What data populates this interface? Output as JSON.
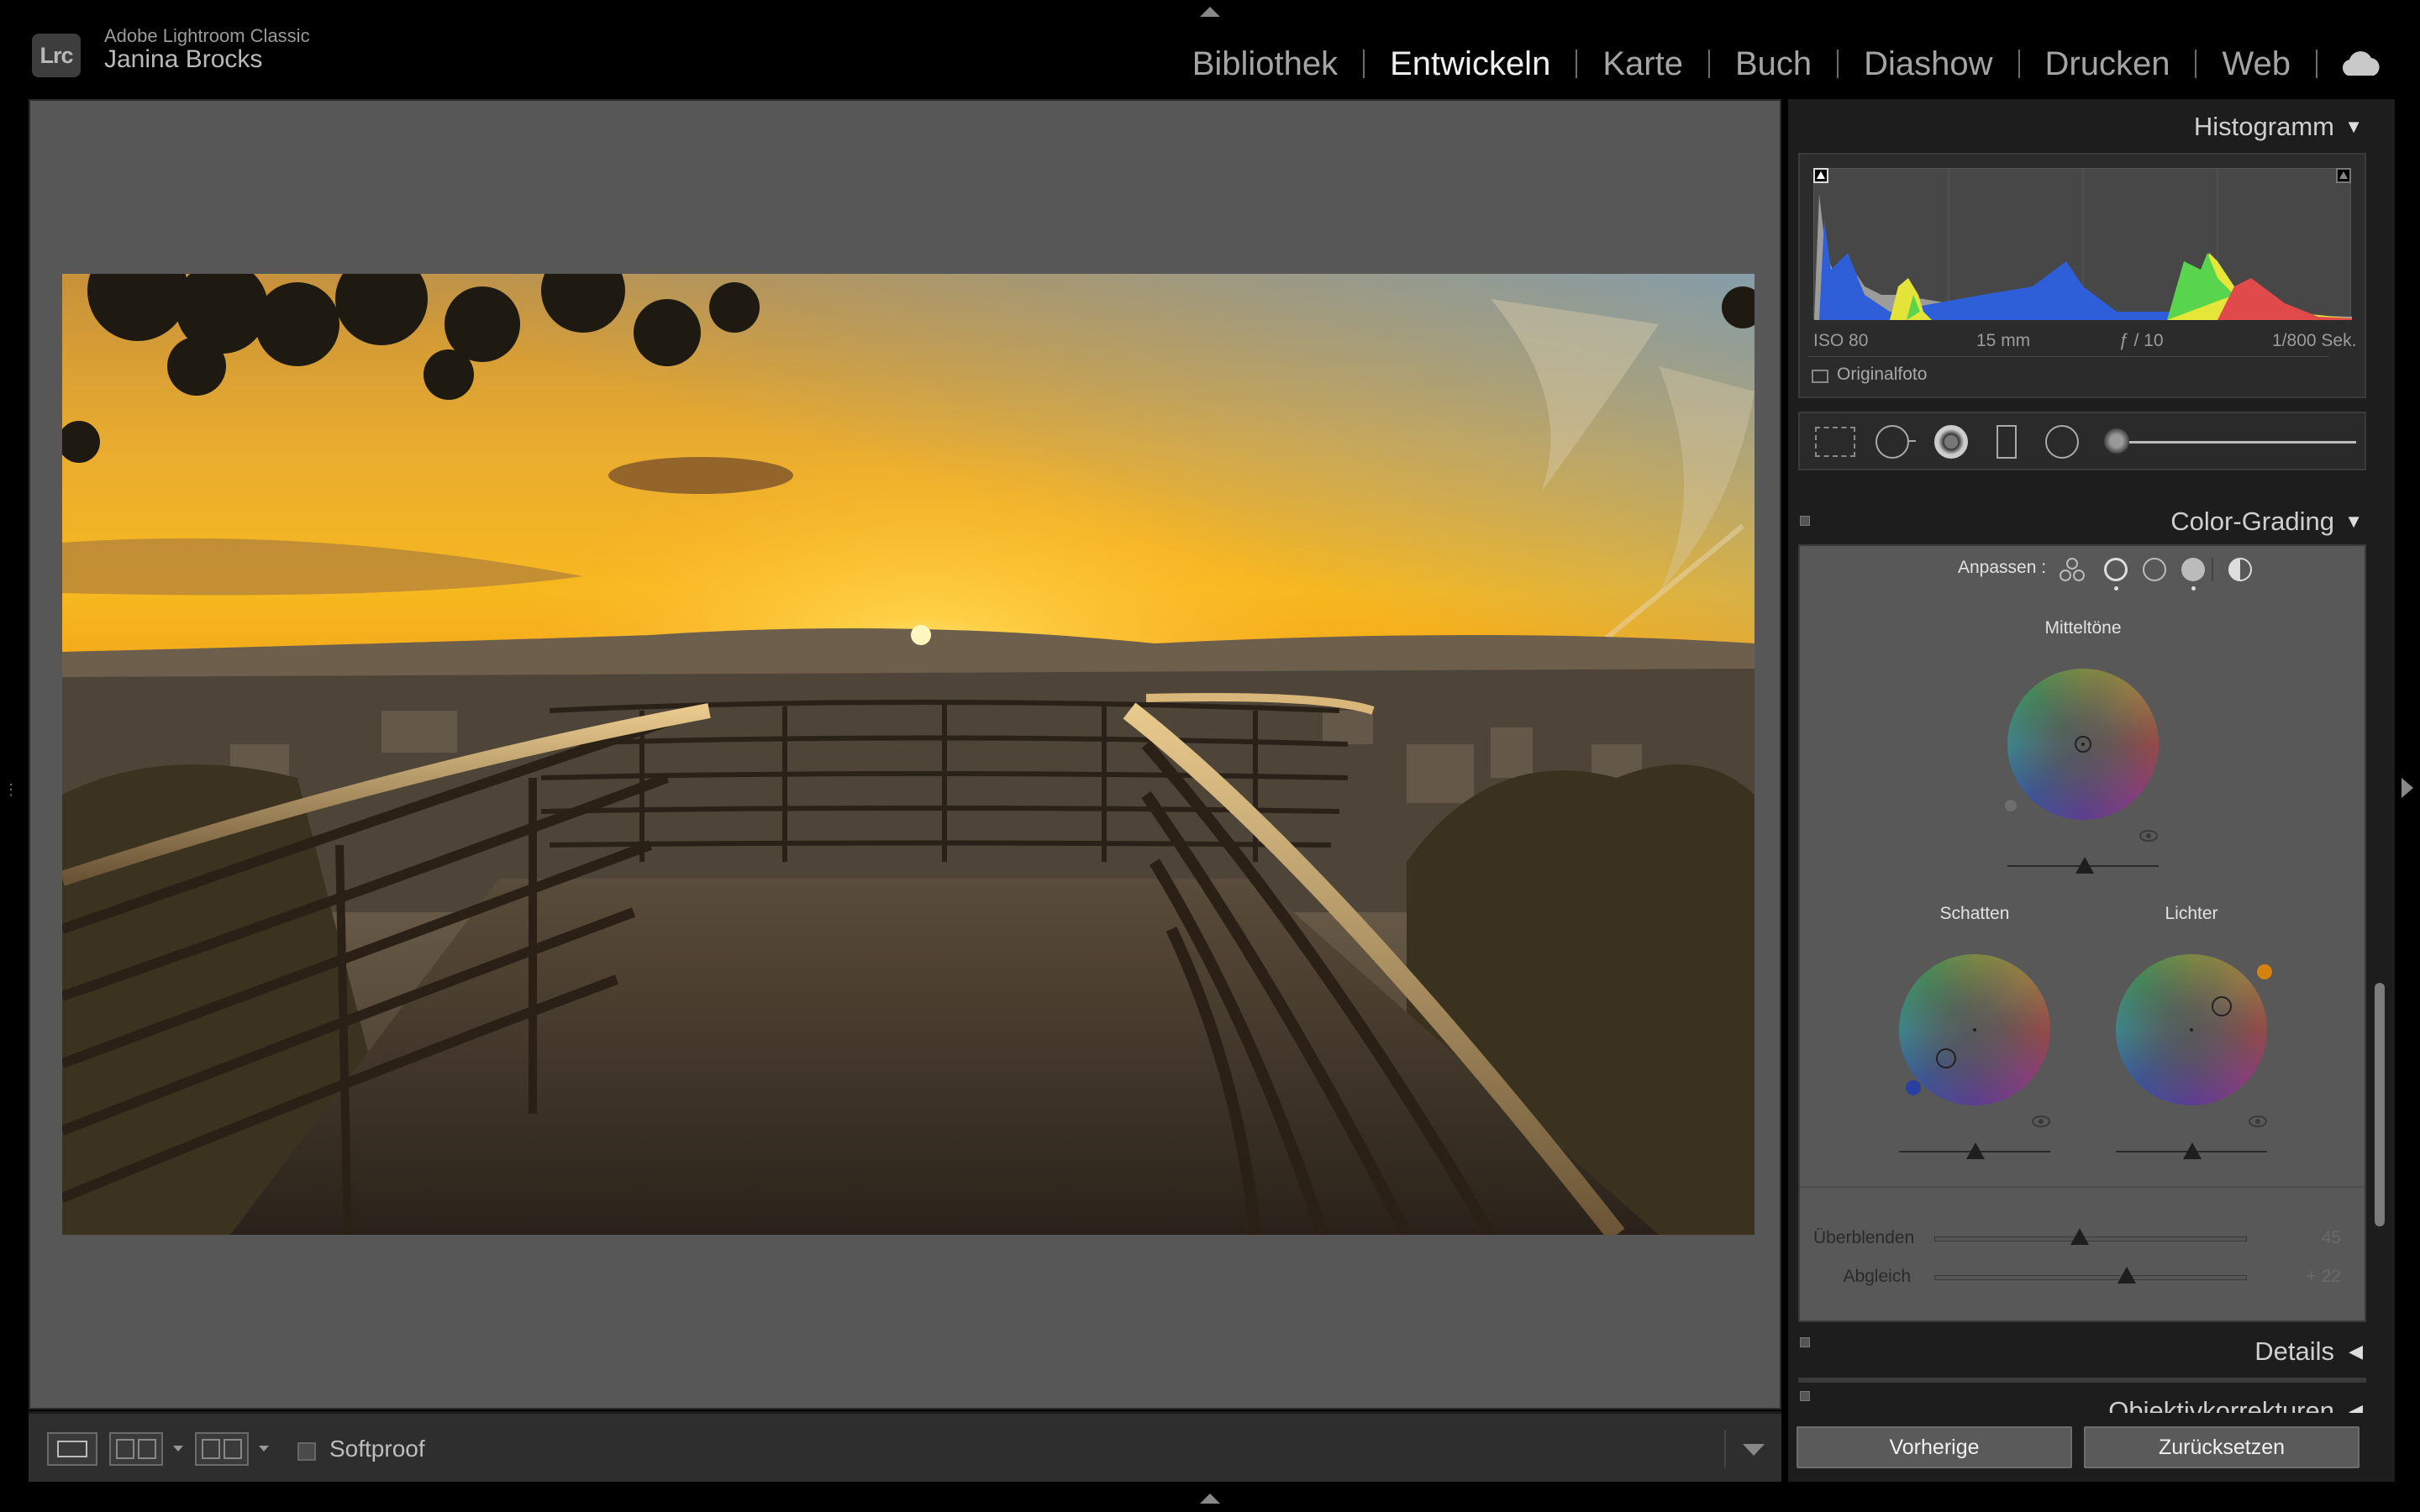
{
  "app": {
    "name": "Adobe Lightroom Classic",
    "logo_text": "Lrc",
    "user": "Janina Brocks"
  },
  "modules": [
    {
      "label": "Bibliothek",
      "active": false
    },
    {
      "label": "Entwickeln",
      "active": true
    },
    {
      "label": "Karte",
      "active": false
    },
    {
      "label": "Buch",
      "active": false
    },
    {
      "label": "Diashow",
      "active": false
    },
    {
      "label": "Drucken",
      "active": false
    },
    {
      "label": "Web",
      "active": false
    }
  ],
  "toolbar": {
    "softproof_label": "Softproof",
    "softproof_checked": false
  },
  "histogram": {
    "title": "Histogramm",
    "iso": "ISO 80",
    "focal_length": "15 mm",
    "aperture": "ƒ / 10",
    "shutter": "1/800 Sek.",
    "original_photo_label": "Originalfoto"
  },
  "color_grading": {
    "title": "Color-Grading",
    "adjust_label": "Anpassen :",
    "midtones_label": "Mitteltöne",
    "shadows_label": "Schatten",
    "highlights_label": "Lichter",
    "blend_label": "Überblenden",
    "blend_value": "45",
    "balance_label": "Abgleich",
    "balance_value": "+ 22"
  },
  "panels": {
    "details": "Details",
    "lens": "Objektivkorrekturen"
  },
  "buttons": {
    "previous": "Vorherige",
    "reset": "Zurücksetzen"
  },
  "colors": {
    "accent_text": "#f0f0f0",
    "panel_bg": "#585858",
    "canvas_bg": "#575757"
  }
}
